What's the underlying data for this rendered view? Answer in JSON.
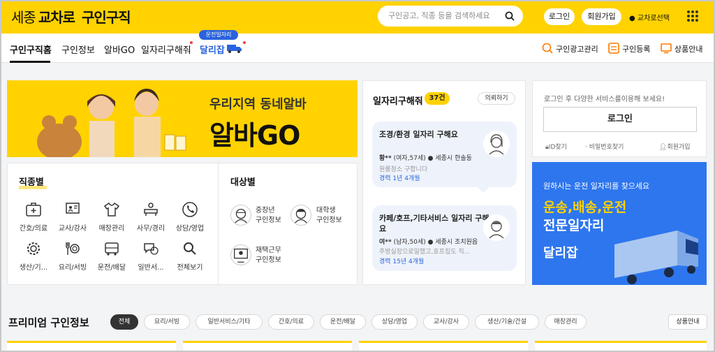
{
  "header": {
    "logo": {
      "part1": "세종",
      "part2": "교차로",
      "part3": "구인구직"
    },
    "search_placeholder": "구인공고, 직종 등을 검색하세요",
    "login_label": "로그인",
    "signup_label": "회원가입",
    "route_label": "교차로선택",
    "colors": {
      "brand": "#ffd200",
      "accent": "#2a63dd"
    }
  },
  "nav": {
    "tabs": [
      {
        "label": "구인구직홈",
        "active": true
      },
      {
        "label": "구인정보"
      },
      {
        "label": "알바GO"
      },
      {
        "label": "일자리구해줘"
      },
      {
        "label": "달리잡"
      }
    ],
    "bubble_label": "운전일자리",
    "right_links": [
      "구인광고관리",
      "구인등록",
      "상품안내"
    ]
  },
  "banner": {
    "line1": "우리지역 동네알바",
    "line2": "알바GO"
  },
  "job_types": {
    "title": "직종별",
    "items": [
      "간호/의료",
      "교사/강사",
      "매장관리",
      "사무/경리",
      "상담/영업",
      "생산/기...",
      "요리/서빙",
      "운전/배달",
      "일반서...",
      "전체보기"
    ]
  },
  "targets": {
    "title": "대상별",
    "items": [
      {
        "line1": "중장년",
        "line2": "구인정보"
      },
      {
        "line1": "대학생",
        "line2": "구인정보"
      },
      {
        "line1": "재택근무",
        "line2": "구인정보"
      }
    ]
  },
  "job_requests": {
    "title": "일자리구해줘",
    "count": "37건",
    "more_label": "의뢰하기",
    "cards": [
      {
        "title": "조경/환경 일자리 구해요",
        "name": "황**",
        "info": "(여자,57세)",
        "location": "세종시 한솔동",
        "desc": "원룸청소 구합니다",
        "career": "경력 1년 4개월"
      },
      {
        "title": "카페/호프,기타서비스 일자리 구해요",
        "name": "여**",
        "info": "(남자,50세)",
        "location": "세종시 조치원읍",
        "desc": "주방실장으로일했고,호프집도 직...",
        "career": "경력 15년 4개월"
      }
    ]
  },
  "login_box": {
    "description": "로그인 후 다양한 서비스를이용해 보세요!",
    "button_label": "로그인",
    "find_id": "ID찾기",
    "find_pw": "비밀번호찾기",
    "signup": "회원가입"
  },
  "ad": {
    "line1": "원하시는 운전 일자리를 찾으세요",
    "line2": "운송,배송,운전",
    "line3": "전문일자리",
    "brand": "달리잡"
  },
  "premium": {
    "title": "프리미엄 구인정보",
    "chips": [
      "전체",
      "요리/서빙",
      "일반서비스/기타",
      "간호/의료",
      "운전/배달",
      "상담/영업",
      "교사/강사",
      "생산/기술/건설",
      "매장관리"
    ],
    "guide_label": "상품안내"
  }
}
